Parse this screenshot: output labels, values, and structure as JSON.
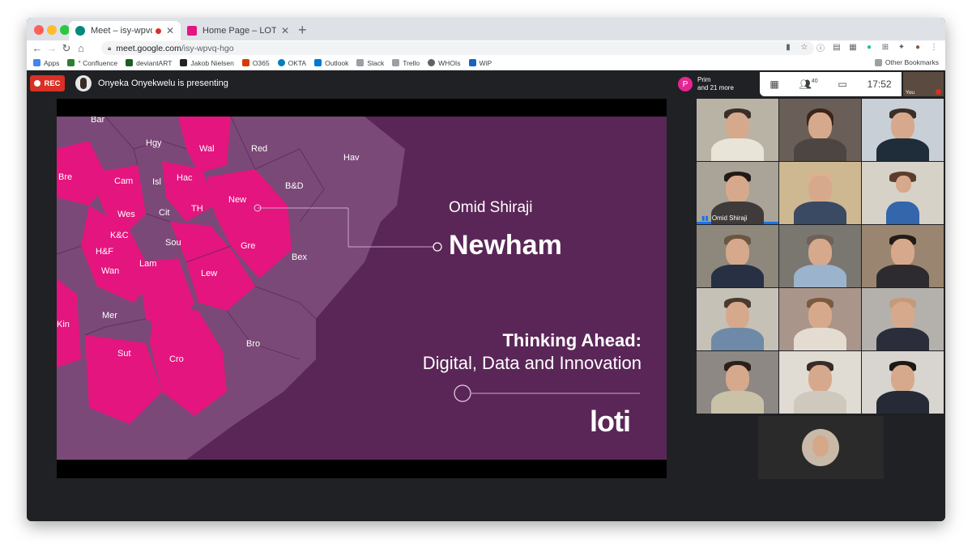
{
  "browser": {
    "tabs": [
      {
        "title": "Meet – isy-wpvq-hgo",
        "active": true
      },
      {
        "title": "Home Page – LOTI",
        "active": false
      }
    ],
    "url_host": "meet.google.com",
    "url_path": "/isy-wpvq-hgo",
    "bookmarks": [
      "Apps",
      "° Confluence",
      "deviantART",
      "Jakob Nielsen",
      "O365",
      "OKTA",
      "Outlook",
      "Slack",
      "Trello",
      "WHOIs",
      "WiP"
    ],
    "other_bookmarks": "Other Bookmarks"
  },
  "meet": {
    "rec_label": "REC",
    "presenting_text": "Onyeka Onyekwelu is presenting",
    "people_chip": {
      "initial": "P",
      "line1": "Prim",
      "line2": "and 21 more"
    },
    "participant_count": "40",
    "time": "17:52",
    "self_label": "You",
    "speaker_name": "Omid Shiraji"
  },
  "slide": {
    "presenter_name": "Omid Shiraji",
    "borough": "Newham",
    "headline": "Thinking Ahead:",
    "subheadline": "Digital, Data and Innovation",
    "logo": "loti",
    "map_labels": [
      "Bar",
      "Hgy",
      "Wal",
      "Red",
      "Hav",
      "Bre",
      "Cam",
      "Isl",
      "Hac",
      "New",
      "B&D",
      "Wes",
      "Cit",
      "TH",
      "K&C",
      "Sou",
      "H&F",
      "Gre",
      "Bex",
      "Wan",
      "Lam",
      "Lew",
      "Mer",
      "Kin",
      "Sut",
      "Cro",
      "Bro"
    ]
  },
  "colors": {
    "slide_bg": "#5a2657",
    "highlight": "#e4157f",
    "muted_map": "#7a4977",
    "rec": "#d93025"
  }
}
